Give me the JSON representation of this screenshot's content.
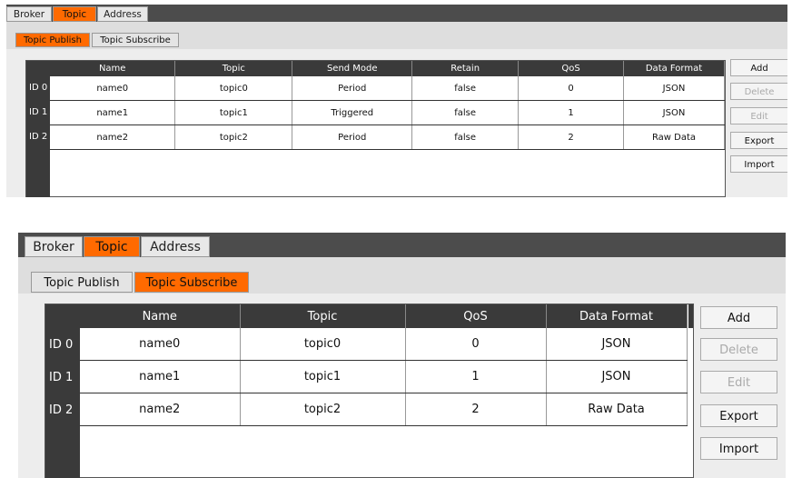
{
  "tabs": [
    "Broker",
    "Topic",
    "Address"
  ],
  "active_tab": "Topic",
  "subtabs": [
    "Topic Publish",
    "Topic Subscribe"
  ],
  "publish": {
    "headers": [
      "Name",
      "Topic",
      "Send Mode",
      "Retain",
      "QoS",
      "Data Format"
    ],
    "rows": [
      {
        "id": "ID 0",
        "cells": [
          "name0",
          "topic0",
          "Period",
          "false",
          "0",
          "JSON"
        ]
      },
      {
        "id": "ID 1",
        "cells": [
          "name1",
          "topic1",
          "Triggered",
          "false",
          "1",
          "JSON"
        ]
      },
      {
        "id": "ID 2",
        "cells": [
          "name2",
          "topic2",
          "Period",
          "false",
          "2",
          "Raw Data"
        ]
      }
    ]
  },
  "subscribe": {
    "headers": [
      "Name",
      "Topic",
      "QoS",
      "Data Format"
    ],
    "rows": [
      {
        "id": "ID 0",
        "cells": [
          "name0",
          "topic0",
          "0",
          "JSON"
        ]
      },
      {
        "id": "ID 1",
        "cells": [
          "name1",
          "topic1",
          "1",
          "JSON"
        ]
      },
      {
        "id": "ID 2",
        "cells": [
          "name2",
          "topic2",
          "2",
          "Raw Data"
        ]
      }
    ]
  },
  "buttons": {
    "add": "Add",
    "delete": "Delete",
    "edit": "Edit",
    "export": "Export",
    "import": "Import"
  },
  "colors": {
    "accent": "#ff6a00",
    "header_bg": "#3a3a3a",
    "panel_bg": "#ededed"
  }
}
